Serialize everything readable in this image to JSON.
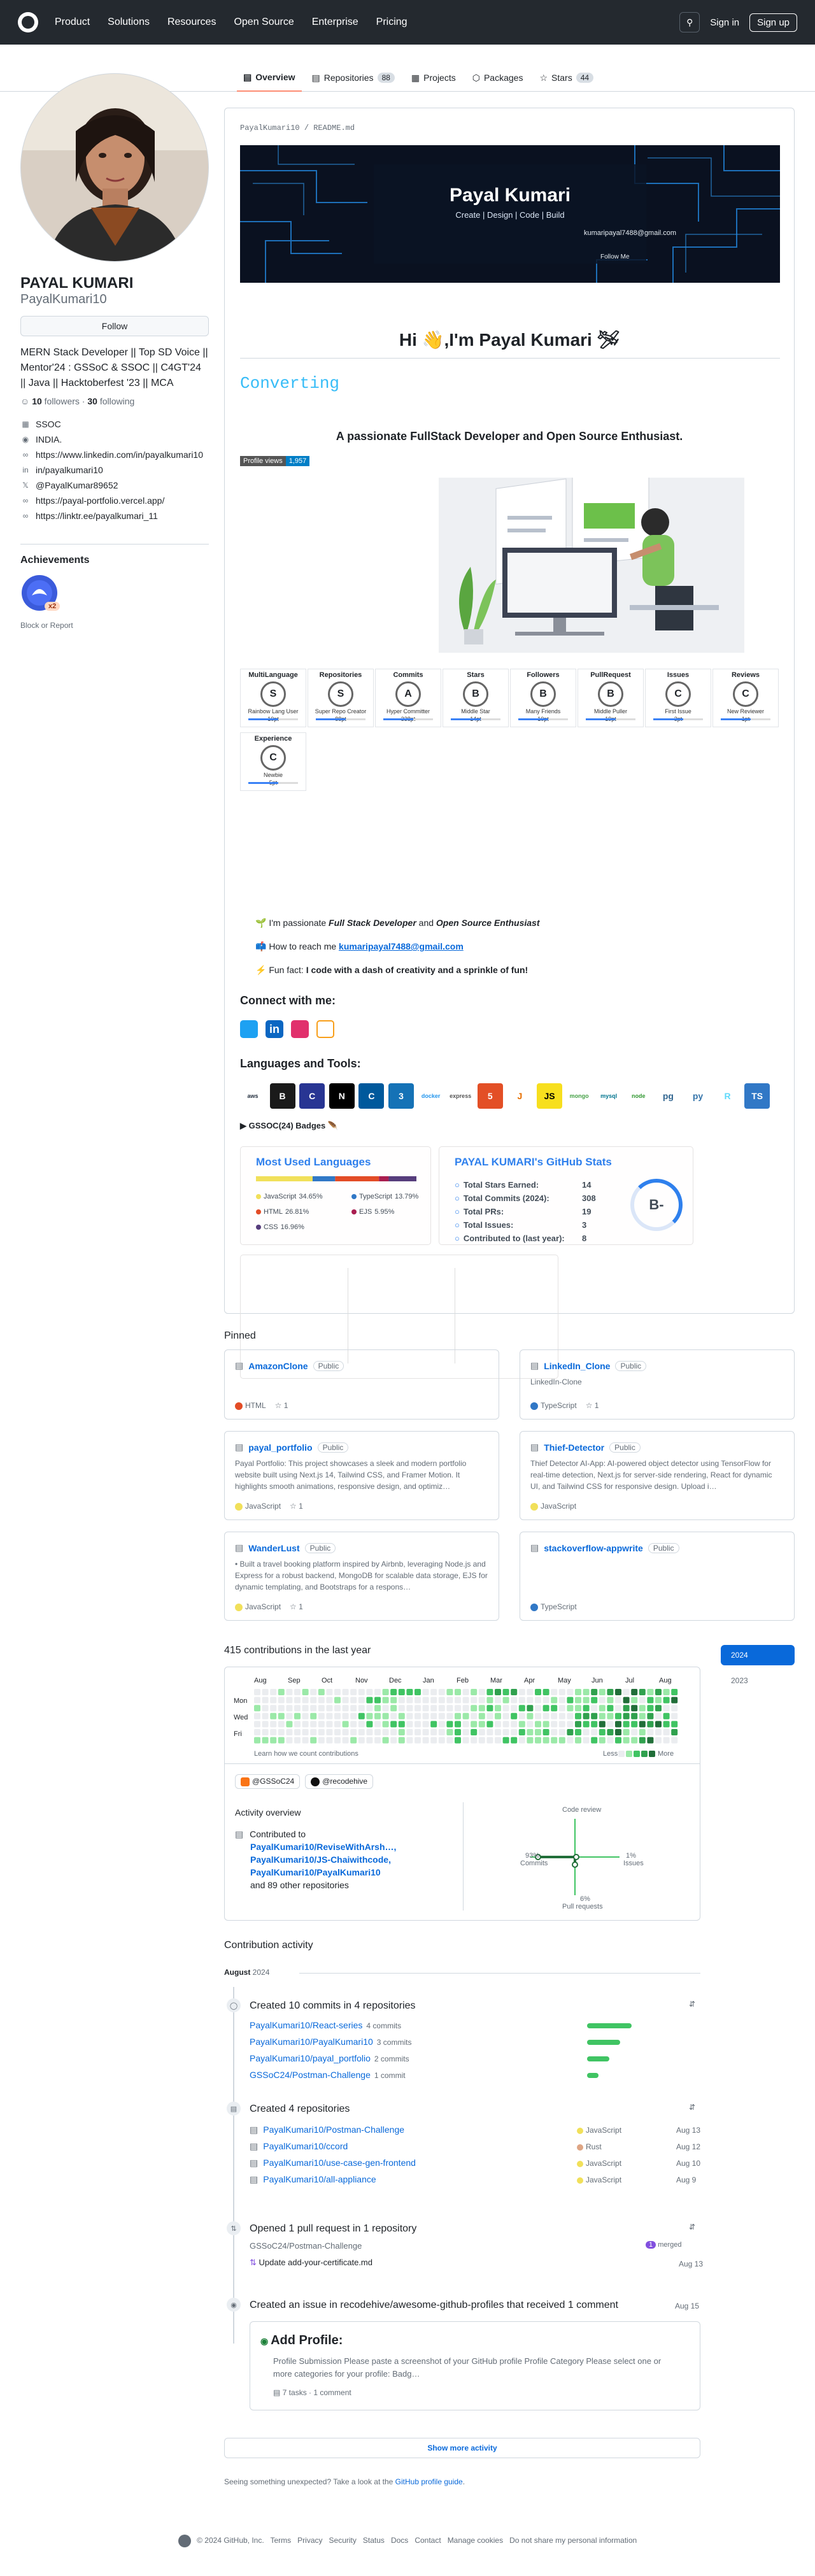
{
  "header": {
    "nav": [
      "Product",
      "Solutions",
      "Resources",
      "Open Source",
      "Enterprise",
      "Pricing"
    ],
    "signin": "Sign in",
    "signup": "Sign up"
  },
  "tabs": [
    {
      "label": "Overview"
    },
    {
      "label": "Repositories",
      "count": "88"
    },
    {
      "label": "Projects"
    },
    {
      "label": "Packages"
    },
    {
      "label": "Stars",
      "count": "44"
    }
  ],
  "profile": {
    "name": "PAYAL KUMARI",
    "login": "PayalKumari10",
    "follow": "Follow",
    "bio": "MERN Stack Developer || Top SD Voice || Mentor'24 : GSSoC & SSOC || C4GT'24 || Java || Hacktoberfest '23 || MCA",
    "followers": "10",
    "followers_label": "followers",
    "following": "30",
    "following_label": "following",
    "details": [
      {
        "icon": "building-icon",
        "text": "SSOC"
      },
      {
        "icon": "location-icon",
        "text": "INDIA."
      },
      {
        "icon": "link-icon",
        "text": "https://www.linkedin.com/in/payalkumari10"
      },
      {
        "icon": "linkedin-icon",
        "text": "in/payalkumari10"
      },
      {
        "icon": "x-icon",
        "text": "@PayalKumar89652"
      },
      {
        "icon": "link-icon",
        "text": "https://payal-portfolio.vercel.app/"
      },
      {
        "icon": "link-icon",
        "text": "https://linktr.ee/payalkumari_11"
      }
    ],
    "achievements": "Achievements",
    "badge_count": "x2",
    "block": "Block or Report"
  },
  "readme": {
    "file_user": "PayalKumari10",
    "file_sep": " / ",
    "file_name": "README.md",
    "banner": {
      "name": "Payal Kumari",
      "tagline": "Create | Design | Code | Build",
      "email": "kumaripayal7488@gmail.com",
      "follow": "Follow Me"
    },
    "hi": "Hi 👋,I'm Payal Kumari 🛩",
    "typing": "Converting",
    "passion": "A passionate FullStack Developer and Open Source Enthusiast.",
    "views_label": "Profile views",
    "views": "1,957",
    "trophies": [
      {
        "t": "MultiLanguage",
        "r": "S",
        "s": "Rainbow Lang User",
        "n": "10pt"
      },
      {
        "t": "Repositories",
        "r": "S",
        "s": "Super Repo Creator",
        "n": "88pt"
      },
      {
        "t": "Commits",
        "r": "A",
        "s": "Hyper Committer",
        "n": "338pt"
      },
      {
        "t": "Stars",
        "r": "B",
        "s": "Middle Star",
        "n": "14pt"
      },
      {
        "t": "Followers",
        "r": "B",
        "s": "Many Friends",
        "n": "10pt"
      },
      {
        "t": "PullRequest",
        "r": "B",
        "s": "Middle Puller",
        "n": "19pt"
      },
      {
        "t": "Issues",
        "r": "C",
        "s": "First Issue",
        "n": "3pt"
      },
      {
        "t": "Reviews",
        "r": "C",
        "s": "New Reviewer",
        "n": "1pt"
      },
      {
        "t": "Experience",
        "r": "C",
        "s": "Newbie",
        "n": "5pt"
      }
    ],
    "bullets": [
      {
        "pre": "🌱 I'm passionate ",
        "b1": "Full Stack Developer",
        "mid": " and ",
        "b2": "Open Source Enthusiast"
      },
      {
        "pre": "📫 How to reach me ",
        "link": "kumaripayal7488@gmail.com"
      },
      {
        "pre": "⚡ Fun fact: ",
        "bold": "I code with a dash of creativity and a sprinkle of fun!"
      }
    ],
    "connect": "Connect with me:",
    "tools": "Languages and Tools:",
    "langs": [
      {
        "t": "aws",
        "c": "#ffffff",
        "f": "#232f3e"
      },
      {
        "t": "B",
        "c": "#1a1a1a",
        "f": "#fff"
      },
      {
        "t": "C",
        "c": "#283593",
        "f": "#fff"
      },
      {
        "t": "N",
        "c": "#000000",
        "f": "#fff"
      },
      {
        "t": "C",
        "c": "#00599c",
        "f": "#fff"
      },
      {
        "t": "3",
        "c": "#1572b6",
        "f": "#fff"
      },
      {
        "t": "docker",
        "c": "#ffffff",
        "f": "#2496ed"
      },
      {
        "t": "express",
        "c": "#ffffff",
        "f": "#555"
      },
      {
        "t": "5",
        "c": "#e34f26",
        "f": "#fff"
      },
      {
        "t": "J",
        "c": "#ffffff",
        "f": "#e76f00"
      },
      {
        "t": "JS",
        "c": "#f7df1e",
        "f": "#000"
      },
      {
        "t": "mongo",
        "c": "#ffffff",
        "f": "#47a248"
      },
      {
        "t": "mysql",
        "c": "#ffffff",
        "f": "#00758f"
      },
      {
        "t": "node",
        "c": "#ffffff",
        "f": "#339933"
      },
      {
        "t": "pg",
        "c": "#ffffff",
        "f": "#336791"
      },
      {
        "t": "py",
        "c": "#ffffff",
        "f": "#3776ab"
      },
      {
        "t": "R",
        "c": "#ffffff",
        "f": "#61dafb"
      },
      {
        "t": "TS",
        "c": "#3178c6",
        "f": "#fff"
      }
    ],
    "badges": "GSSOC(24) Badges 🪶",
    "langs_card": {
      "title": "Most Used Languages",
      "items": [
        {
          "n": "JavaScript",
          "p": "34.65%",
          "c": "#f1e05a"
        },
        {
          "n": "TypeScript",
          "p": "13.79%",
          "c": "#3178c6"
        },
        {
          "n": "HTML",
          "p": "26.81%",
          "c": "#e34c26"
        },
        {
          "n": "EJS",
          "p": "5.95%",
          "c": "#a91e50"
        },
        {
          "n": "CSS",
          "p": "16.96%",
          "c": "#563d7c"
        }
      ]
    },
    "stats_card": {
      "title": "PAYAL KUMARI's GitHub Stats",
      "rows": [
        {
          "l": "Total Stars Earned:",
          "v": "14"
        },
        {
          "l": "Total Commits (2024):",
          "v": "308"
        },
        {
          "l": "Total PRs:",
          "v": "19"
        },
        {
          "l": "Total Issues:",
          "v": "3"
        },
        {
          "l": "Contributed to (last year):",
          "v": "8"
        }
      ],
      "grade": "B-"
    }
  },
  "pinned": {
    "title": "Pinned",
    "items": [
      {
        "name": "AmazonClone",
        "vis": "Public",
        "desc": "",
        "lang": "HTML",
        "lc": "#e34c26",
        "stars": "1"
      },
      {
        "name": "LinkedIn_Clone",
        "vis": "Public",
        "desc": "LinkedIn-Clone",
        "lang": "TypeScript",
        "lc": "#3178c6",
        "stars": "1"
      },
      {
        "name": "payal_portfolio",
        "vis": "Public",
        "desc": "Payal Portfolio: This project showcases a sleek and modern portfolio website built using Next.js 14, Tailwind CSS, and Framer Motion. It highlights smooth animations, responsive design, and optimiz…",
        "lang": "JavaScript",
        "lc": "#f1e05a",
        "stars": "1"
      },
      {
        "name": "Thief-Detector",
        "vis": "Public",
        "desc": "Thief Detector AI-App: AI-powered object detector using TensorFlow for real-time detection, Next.js for server-side rendering, React for dynamic UI, and Tailwind CSS for responsive design. Upload i…",
        "lang": "JavaScript",
        "lc": "#f1e05a",
        "stars": ""
      },
      {
        "name": "WanderLust",
        "vis": "Public",
        "desc": "• Built a travel booking platform inspired by Airbnb, leveraging Node.js and Express for a robust backend, MongoDB for scalable data storage, EJS for dynamic templating, and Bootstraps for a respons…",
        "lang": "JavaScript",
        "lc": "#f1e05a",
        "stars": "1"
      },
      {
        "name": "stackoverflow-appwrite",
        "vis": "Public",
        "desc": "",
        "lang": "TypeScript",
        "lc": "#3178c6",
        "stars": ""
      }
    ]
  },
  "contrib": {
    "title": "415 contributions in the last year",
    "months": [
      "Aug",
      "Sep",
      "Oct",
      "Nov",
      "Dec",
      "Jan",
      "Feb",
      "Mar",
      "Apr",
      "May",
      "Jun",
      "Jul",
      "Aug"
    ],
    "days": [
      "Mon",
      "Wed",
      "Fri"
    ],
    "learn": "Learn how we count contributions",
    "less": "Less",
    "more": "More",
    "years": [
      "2024",
      "2023"
    ],
    "orgs": [
      "@GSSoC24",
      "@recodehive"
    ],
    "overview": "Activity overview",
    "contributed_to": "Contributed to",
    "repos": [
      "PayalKumari10/ReviseWithArsh…,",
      "PayalKumari10/JS-Chaiwithcode,",
      "PayalKumari10/PayalKumari10"
    ],
    "others": "and 89 other repositories",
    "code_review": "Code review",
    "commits_pct": "93%",
    "commits_lbl": "Commits",
    "issues_pct": "1%",
    "issues_lbl": "Issues",
    "pr_pct": "6%",
    "pr_lbl": "Pull requests"
  },
  "activity": {
    "title": "Contribution activity",
    "month": "August",
    "year": "2024",
    "commits": {
      "text": "Created 10 commits in 4 repositories",
      "rows": [
        {
          "r": "PayalKumari10/React-series",
          "c": "4 commits",
          "w": 70
        },
        {
          "r": "PayalKumari10/PayalKumari10",
          "c": "3 commits",
          "w": 52
        },
        {
          "r": "PayalKumari10/payal_portfolio",
          "c": "2 commits",
          "w": 35
        },
        {
          "r": "GSSoC24/Postman-Challenge",
          "c": "1 commit",
          "w": 18
        }
      ]
    },
    "repos": {
      "text": "Created 4 repositories",
      "rows": [
        {
          "r": "PayalKumari10/Postman-Challenge",
          "l": "JavaScript",
          "lc": "#f1e05a",
          "d": "Aug 13"
        },
        {
          "r": "PayalKumari10/ccord",
          "l": "Rust",
          "lc": "#dea584",
          "d": "Aug 12"
        },
        {
          "r": "PayalKumari10/use-case-gen-frontend",
          "l": "JavaScript",
          "lc": "#f1e05a",
          "d": "Aug 10"
        },
        {
          "r": "PayalKumari10/all-appliance",
          "l": "JavaScript",
          "lc": "#f1e05a",
          "d": "Aug 9"
        }
      ]
    },
    "pr": {
      "text": "Opened 1 pull request in 1 repository",
      "repo": "GSSoC24/Postman-Challenge",
      "count": "1",
      "state": "merged",
      "title": "Update add-your-certificate.md",
      "date": "Aug 13"
    },
    "issue": {
      "text": "Created an issue in recodehive/awesome-github-profiles that received 1 comment",
      "date": "Aug 15",
      "title": "Add Profile:",
      "body": "Profile Submission Please paste a screenshot of your GitHub profile Profile Category Please select one or more categories for your profile: Badg…",
      "tasks": "7 tasks",
      "comments": "1 comment"
    },
    "more": "Show more activity",
    "unexpected": "Seeing something unexpected? Take a look at the",
    "guide": "GitHub profile guide",
    "dot": "."
  },
  "footer": [
    "© 2024 GitHub, Inc.",
    "Terms",
    "Privacy",
    "Security",
    "Status",
    "Docs",
    "Contact",
    "Manage cookies",
    "Do not share my personal information"
  ]
}
